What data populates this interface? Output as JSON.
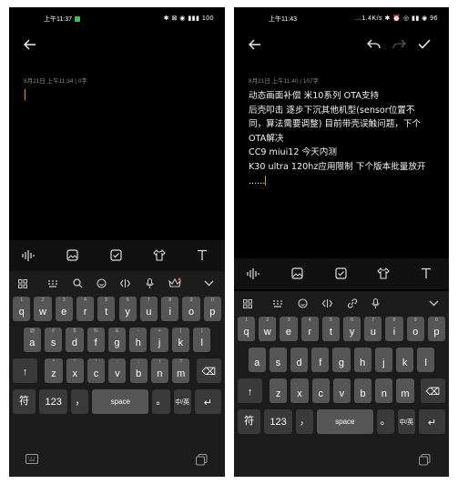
{
  "left": {
    "status": {
      "time": "上午11:37",
      "right": "✱ ⊠ ◉ ▮▮▮ 100"
    },
    "note": {
      "meta": "8月21日  上午11:34 | 0字"
    },
    "keyboard": {
      "rows": [
        [
          [
            "q",
            "1"
          ],
          [
            "w",
            "2"
          ],
          [
            "e",
            "3"
          ],
          [
            "r",
            "4"
          ],
          [
            "t",
            "5"
          ],
          [
            "y",
            "6"
          ],
          [
            "u",
            "7"
          ],
          [
            "i",
            "8"
          ],
          [
            "o",
            "9"
          ],
          [
            "p",
            "0"
          ]
        ],
        [
          [
            "a",
            "@"
          ],
          [
            "s",
            "#"
          ],
          [
            "d",
            "$"
          ],
          [
            "f",
            "%"
          ],
          [
            "g",
            "&"
          ],
          [
            "h",
            "-"
          ],
          [
            "j",
            "+"
          ],
          [
            "k",
            "("
          ],
          [
            "l",
            ")"
          ]
        ],
        [
          [
            "z",
            "*"
          ],
          [
            "x",
            "\""
          ],
          [
            "c",
            "'"
          ],
          [
            "v",
            ":"
          ],
          [
            "b",
            ";"
          ],
          [
            "n",
            "!"
          ],
          [
            "m",
            "?"
          ]
        ]
      ],
      "sym": "符",
      "num": "123",
      "comma": "，",
      "space": "space",
      "period": "。",
      "lang": "中/英"
    }
  },
  "right": {
    "status": {
      "time": "上午11:43",
      "right": "...1.4K/s ✱ ⏰ ◎ ▮▮ ◉ 96"
    },
    "note": {
      "meta": "8月21日  上午11:40 | 107字",
      "lines": [
        "动态画面补偿   米10系列 OTA支持",
        "后壳叩击 逐步下沉其他机型(sensor位置不",
        "同，算法需要调整) 目前带壳误触问题，下个",
        "OTA解决",
        "CC9 miui12  今天内测",
        "K30 ultra 120hz应用限制 下个版本批量放开",
        "......"
      ]
    },
    "keyboard": {
      "rows": [
        [
          [
            "q",
            "1"
          ],
          [
            "w",
            "2"
          ],
          [
            "e",
            "3"
          ],
          [
            "r",
            "4"
          ],
          [
            "t",
            "5"
          ],
          [
            "y",
            "6"
          ],
          [
            "u",
            "7"
          ],
          [
            "i",
            "8"
          ],
          [
            "o",
            "9"
          ],
          [
            "p",
            "0"
          ]
        ],
        [
          [
            "a",
            ""
          ],
          [
            "s",
            ""
          ],
          [
            "d",
            ""
          ],
          [
            "f",
            ""
          ],
          [
            "g",
            ""
          ],
          [
            "h",
            ""
          ],
          [
            "j",
            ""
          ],
          [
            "k",
            ""
          ],
          [
            "l",
            ""
          ]
        ],
        [
          [
            "z",
            ""
          ],
          [
            "x",
            ""
          ],
          [
            "c",
            ""
          ],
          [
            "v",
            ""
          ],
          [
            "b",
            ""
          ],
          [
            "n",
            ""
          ],
          [
            "m",
            ""
          ]
        ]
      ],
      "sym": "符",
      "num": "123",
      "comma": "，",
      "space": "space",
      "period": "。",
      "lang": "中/英"
    }
  }
}
